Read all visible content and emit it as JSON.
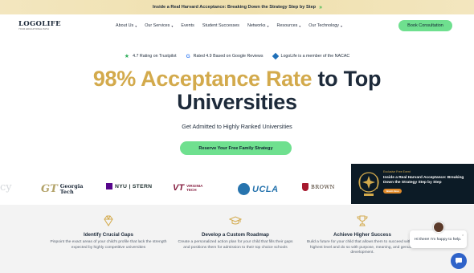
{
  "announcement": {
    "text": "Inside a Real Harvard Acceptance: Breaking Down the Strategy Step by Step",
    "arrow_icon": "double-chevron-right-icon"
  },
  "nav": {
    "logo": {
      "main": "LOGOLIFE",
      "tagline": "YOUR EDUCATIONAL PATH"
    },
    "menu": [
      {
        "label": "About Us",
        "dropdown": true
      },
      {
        "label": "Our Services",
        "dropdown": true
      },
      {
        "label": "Events",
        "dropdown": false
      },
      {
        "label": "Student Successes",
        "dropdown": false
      },
      {
        "label": "Networks",
        "dropdown": true
      },
      {
        "label": "Resources",
        "dropdown": true
      },
      {
        "label": "Our Technology",
        "dropdown": true
      }
    ],
    "cta": "Book Consultation"
  },
  "trust": [
    {
      "icon": "star-icon",
      "text": "4.7 Rating on Trustpilot"
    },
    {
      "icon": "google-icon",
      "text": "Rated 4.9 Based on Google Reviews"
    },
    {
      "icon": "nacac-icon",
      "text": "LogoLife is a member of the NACAC"
    }
  ],
  "hero": {
    "headline_gold": "98% Acceptance Rate",
    "headline_dark_1": "to Top",
    "headline_dark_2": "Universities",
    "subtitle": "Get Admitted to Highly Ranked Universities",
    "cta": "Reserve Your Free Family Strategy"
  },
  "universities": {
    "partial": "cy",
    "gt": {
      "mark": "GT",
      "line1": "Georgia",
      "line2": "Tech"
    },
    "nyu": {
      "text": "NYU | STERN"
    },
    "vt": {
      "mark": "VT",
      "line1": "VIRGINIA",
      "line2": "TECH"
    },
    "ucla": {
      "text": "UCLA"
    },
    "brown": {
      "text": "BROWN"
    }
  },
  "promo": {
    "eyebrow": "Exclusive Free Event",
    "title": "Inside a Real Harvard Acceptance: Breaking Down the Strategy Step by Step",
    "button": "Watch Now"
  },
  "features": [
    {
      "icon": "diamond-icon",
      "title": "Identify Crucial Gaps",
      "text": "Pinpoint the exact areas of your child's profile that lack the strength expected by highly competitive universities"
    },
    {
      "icon": "graduation-cap-icon",
      "title": "Develop a Custom Roadmap",
      "text": "Create a personalized action plan for your child that fills their gaps and positions them for admission to their top choice schools"
    },
    {
      "icon": "trophy-icon",
      "title": "Achieve Higher Success",
      "text": "Build a future for your child that allows them to succeed with the highest level and do so with purpose, meaning, and genuine development."
    }
  ],
  "chat": {
    "message": "Hi there! I'm happy to help.",
    "close": "×"
  },
  "colors": {
    "gold": "#d3aa4c",
    "green": "#6fe08f",
    "navy": "#1d2a3a",
    "promo_bg": "#0c1b26",
    "chat_blue": "#2f63c9"
  }
}
